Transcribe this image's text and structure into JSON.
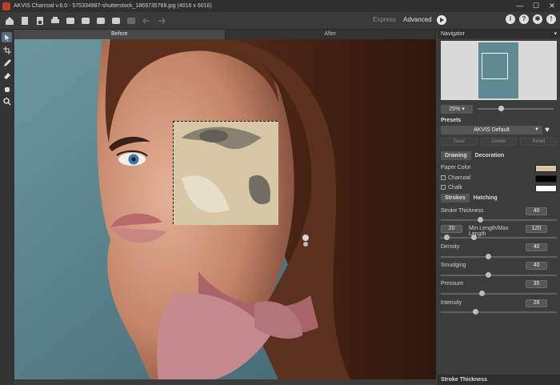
{
  "window": {
    "title": "AKVIS Charcoal v.6.0 - 575334987-shutterstock_1869735769.jpg (4016 x 6016)"
  },
  "toolbar": {
    "mode_express": "Express",
    "mode_advanced": "Advanced"
  },
  "view_tabs": [
    "Before",
    "After"
  ],
  "navigator": {
    "title": "Navigator",
    "zoom": "25%"
  },
  "presets": {
    "title": "Presets",
    "selected": "AKVIS Default",
    "save": "Save",
    "delete": "Delete",
    "reset": "Reset"
  },
  "panel_tabs": [
    "Drawing",
    "Decoration"
  ],
  "drawing": {
    "paper_color_label": "Paper Color",
    "charcoal_label": "Charcoal",
    "chalk_label": "Chalk",
    "paper_color": "#d6c6a6",
    "charcoal_color": "#000000",
    "chalk_color": "#ffffff"
  },
  "sub_tabs": [
    "Strokes",
    "Hatching"
  ],
  "params": {
    "stroke_thickness": {
      "label": "Stroke Thickness",
      "value": "40"
    },
    "min_length": "20",
    "minmax_label": "Min Length/Max Length",
    "max_length": "120",
    "density": {
      "label": "Density",
      "value": "40"
    },
    "smudging": {
      "label": "Smudging",
      "value": "40"
    },
    "pressure": {
      "label": "Pressure",
      "value": "35"
    },
    "intensity": {
      "label": "Intensity",
      "value": "28"
    }
  },
  "footer": {
    "label": "Stroke Thickness"
  }
}
